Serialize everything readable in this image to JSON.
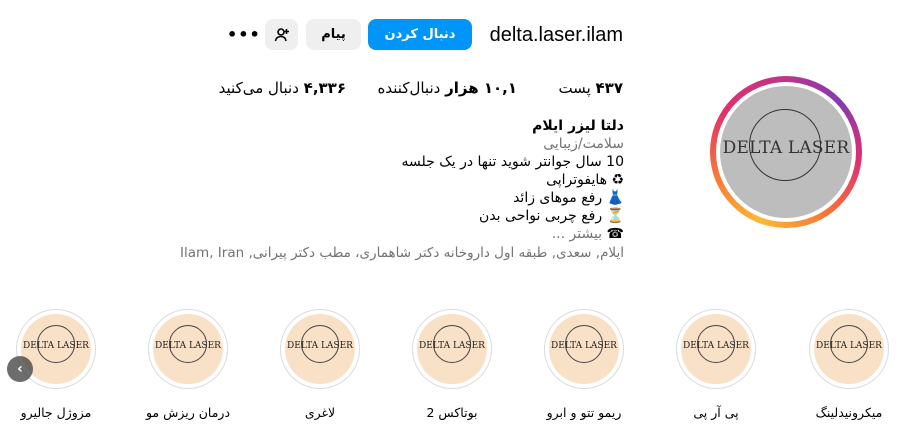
{
  "profile": {
    "username": "delta.laser.ilam",
    "avatar_logo_text": "DELTA LASER"
  },
  "actions": {
    "follow_label": "دنبال کردن",
    "message_label": "پیام",
    "suggest_icon": "person-plus-icon",
    "more_icon": "more-horizontal-icon",
    "more_label": "•••"
  },
  "stats": {
    "posts_value": "۴۳۷",
    "posts_label": "پست",
    "followers_value": "۱۰,۱ هزار",
    "followers_label": "دنبال‌کننده",
    "following_value": "۴,۳۳۶",
    "following_label": "دنبال می‌کنید"
  },
  "bio": {
    "name": "دلتا لیزر ایلام",
    "category": "سلامت/زیبایی",
    "line1": "10 سال جوانتر شوید تنها در یک جلسه",
    "line2": "♻ هایفوتراپی",
    "line3": "👗 رفع موهای زائد",
    "line4": "⏳ رفع چربی نواحی بدن",
    "more_prefix": "☎",
    "more_label": "بیشتر ...",
    "address": "ایلام, سعدی, طبقه اول داروخانه دکتر شاهماری، مطب دکتر پیرانی, Ilam, Iran"
  },
  "highlights": [
    {
      "label": "میکرونیدلینگ",
      "logo": "DELTA LASER"
    },
    {
      "label": "پی آر پی",
      "logo": "DELTA LASER"
    },
    {
      "label": "ریمو تتو و ابرو",
      "logo": "DELTA LASER"
    },
    {
      "label": "بوتاکس 2",
      "logo": "DELTA LASER"
    },
    {
      "label": "لاغری",
      "logo": "DELTA LASER"
    },
    {
      "label": "درمان ریزش مو",
      "logo": "DELTA LASER"
    },
    {
      "label": "مزوژل جالیرو",
      "logo": "DELTA LASER"
    }
  ],
  "carousel": {
    "prev_icon": "chevron-left-icon",
    "prev_glyph": "‹"
  },
  "colors": {
    "primary": "#0095f6",
    "secondary_button": "#efefef",
    "muted_text": "#737373",
    "highlight_bg": "#f9e1c8"
  }
}
